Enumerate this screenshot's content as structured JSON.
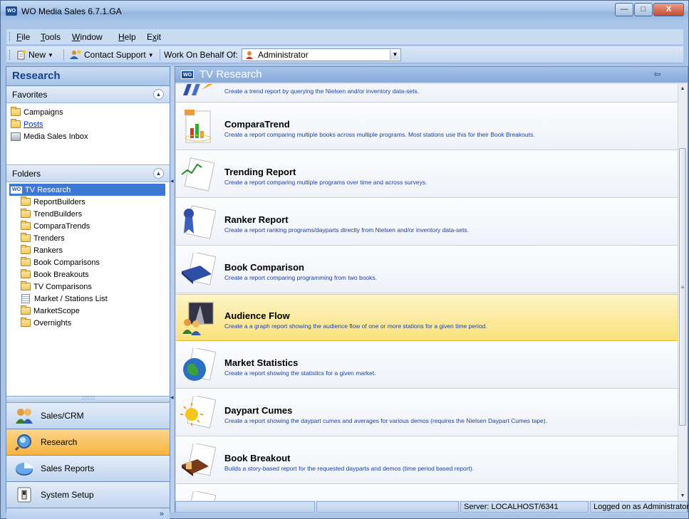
{
  "window": {
    "app_icon": "WO",
    "title": "WO Media Sales 6.7.1.GA",
    "controls": {
      "minimize": "—",
      "maximize": "□",
      "close": "X"
    }
  },
  "menu": {
    "items": [
      "File",
      "Tools",
      "Window",
      "Help",
      "Exit"
    ],
    "underline": [
      "F",
      "T",
      "W",
      "H",
      "x"
    ]
  },
  "toolbar": {
    "new_label": "New",
    "contact_label": "Contact Support",
    "behalf_label": "Work On Behalf Of:",
    "behalf_value": "Administrator"
  },
  "left_panel": {
    "title": "Research",
    "favorites": {
      "label": "Favorites",
      "items": [
        "Campaigns",
        "Posts",
        "Media Sales Inbox"
      ]
    },
    "folders": {
      "label": "Folders",
      "root": "TV Research",
      "root_badge": "WO",
      "children": [
        "ReportBuilders",
        "TrendBuilders",
        "ComparaTrends",
        "Trenders",
        "Rankers",
        "Book Comparisons",
        "Book Breakouts",
        "TV Comparisons",
        "Market / Stations List",
        "MarketScope",
        "Overnights"
      ]
    },
    "nav": [
      "Sales/CRM",
      "Research",
      "Sales Reports",
      "System Setup"
    ]
  },
  "right_panel": {
    "title": "TV Research",
    "badge": "WO",
    "items": [
      {
        "name": "",
        "desc": "Create a trend report by querying the Nielsen and/or inventory data-sets."
      },
      {
        "name": "ComparaTrend",
        "desc": "Create a report comparing multiple books across multiple programs.  Most stations use this for their Book Breakouts."
      },
      {
        "name": "Trending Report",
        "desc": "Create a report comparing multiple programs over time and across surveys."
      },
      {
        "name": "Ranker Report",
        "desc": "Create a report ranking programs/dayparts directly from Nielsen and/or inventory data-sets."
      },
      {
        "name": "Book Comparison",
        "desc": "Create a report comparing programming from two books."
      },
      {
        "name": "Audience Flow",
        "desc": "Create a a graph report showing the audience flow of one or more stations for a given time period."
      },
      {
        "name": "Market Statistics",
        "desc": "Create a report showing the statistics for a given market."
      },
      {
        "name": "Daypart Cumes",
        "desc": "Create a report showing the daypart cumes and averages for various demos (requires the Nielsen Daypart Cumes tape)."
      },
      {
        "name": "Book Breakout",
        "desc": "Builds a story-based report for the requested dayparts and demos (time period based report)."
      }
    ]
  },
  "status": {
    "server": "Server: LOCALHOST/6341",
    "user": "Logged on as Administrator"
  },
  "colors": {
    "accent": "#1b4f9c",
    "selected_row": "#fbe17c",
    "active_nav": "#f7b441"
  }
}
